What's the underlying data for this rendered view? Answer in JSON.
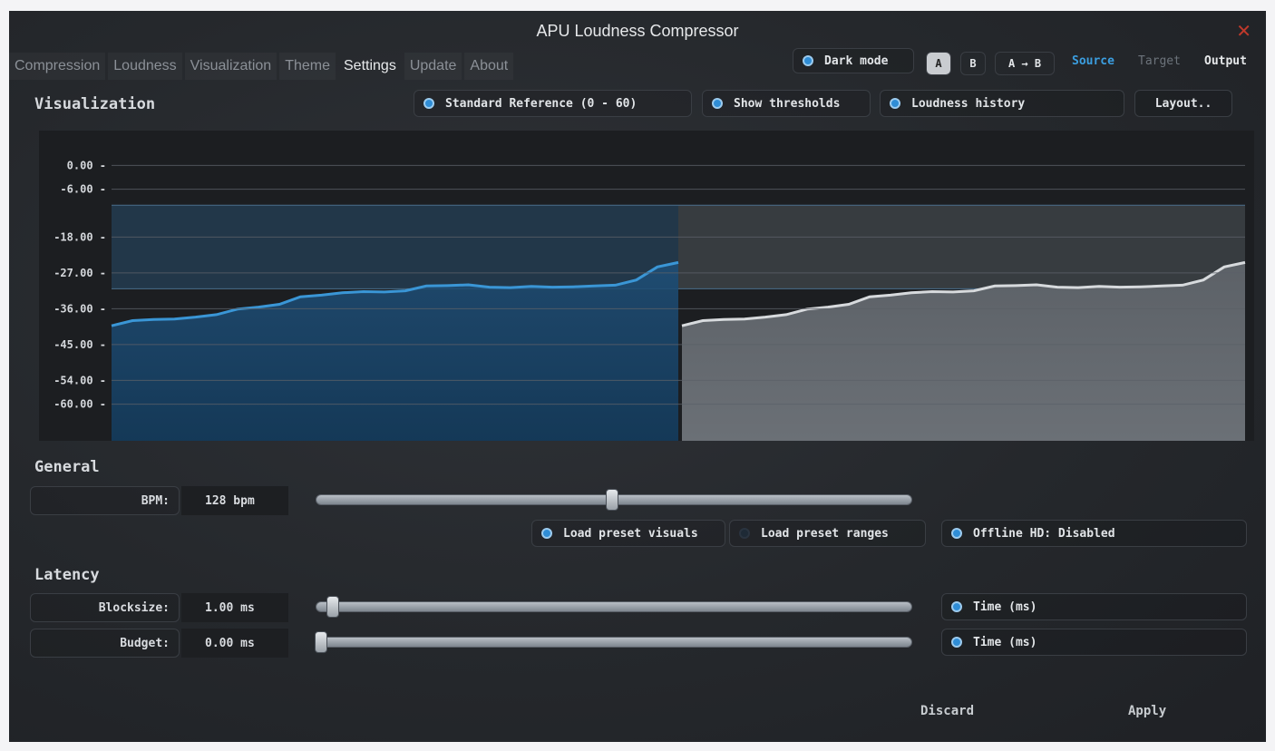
{
  "window": {
    "title": "APU Loudness Compressor",
    "close_icon": "close-icon",
    "close_glyph": "✕"
  },
  "tabs": [
    "Compression",
    "Loudness",
    "Visualization",
    "Theme",
    "Settings",
    "Update",
    "About"
  ],
  "active_tab": "Settings",
  "header": {
    "dark_mode": "Dark mode",
    "a_label": "A",
    "b_label": "B",
    "ab_label": "A → B",
    "view_source": "Source",
    "view_target": "Target",
    "view_output": "Output"
  },
  "visualization": {
    "heading": "Visualization",
    "standard_reference": "Standard Reference (0 - 60)",
    "show_thresholds": "Show thresholds",
    "loudness_history": "Loudness history",
    "layout_button": "Layout.."
  },
  "chart_data": {
    "type": "area",
    "y_ticks": [
      "0.00",
      "-6.00",
      "-18.00",
      "-27.00",
      "-36.00",
      "-45.00",
      "-54.00",
      "-60.00"
    ],
    "ylim": [
      -66,
      6
    ],
    "threshold_band": [
      -31,
      -10
    ],
    "series": [
      {
        "values": [
          -40.3,
          -39.0,
          -38.7,
          -38.6,
          -38.1,
          -37.5,
          -36.1,
          -35.6,
          -34.9,
          -33.0,
          -32.6,
          -32.0,
          -31.7,
          -31.8,
          -31.5,
          -30.3,
          -30.2,
          -30.0,
          -30.6,
          -30.7,
          -30.4,
          -30.6,
          -30.5,
          -30.3,
          -30.1,
          -28.8,
          -25.5,
          -24.4
        ]
      },
      {
        "values": [
          -40.3,
          -39.0,
          -38.7,
          -38.6,
          -38.1,
          -37.5,
          -36.1,
          -35.6,
          -34.9,
          -33.0,
          -32.6,
          -32.0,
          -31.7,
          -31.8,
          -31.5,
          -30.3,
          -30.2,
          -30.0,
          -30.6,
          -30.7,
          -30.4,
          -30.6,
          -30.5,
          -30.3,
          -30.1,
          -28.8,
          -25.5,
          -24.4
        ]
      }
    ],
    "colors": {
      "left_fill": "#1f4f78",
      "left_line": "#3a96d6",
      "right_fill": "#6b7076",
      "right_line": "#d7dadd",
      "band": "#233a4e"
    }
  },
  "general": {
    "heading": "General",
    "bpm_label": "BPM:",
    "bpm_value": "128 bpm",
    "bpm_slider": 0.5,
    "load_preset_visuals": "Load preset visuals",
    "load_preset_ranges": "Load preset ranges",
    "offline_hd": "Offline HD: Disabled"
  },
  "latency": {
    "heading": "Latency",
    "blocksize_label": "Blocksize:",
    "blocksize_value": "1.00 ms",
    "blocksize_slider": 0.02,
    "budget_label": "Budget:",
    "budget_value": "0.00 ms",
    "budget_slider": 0.0,
    "time_ms_1": "Time (ms)",
    "time_ms_2": "Time (ms)"
  },
  "footer": {
    "discard": "Discard",
    "apply": "Apply"
  },
  "colors": {
    "accent": "#2f8dd6",
    "source": "#3b9ee0",
    "target": "#6c737b",
    "close": "#c0392b"
  }
}
